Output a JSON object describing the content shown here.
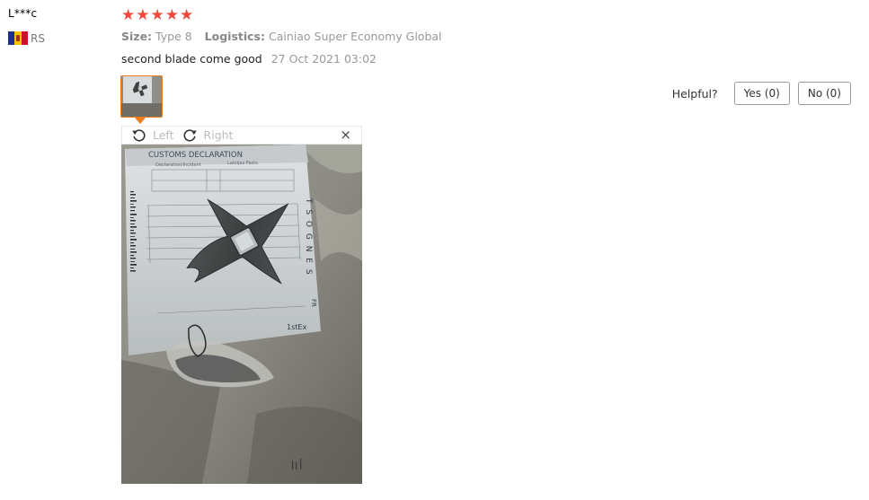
{
  "reviewer": {
    "name": "L***c",
    "country_code": "RS",
    "flag_icon": "flag-icon"
  },
  "rating": {
    "stars": 5,
    "max": 5,
    "color": "#f04a3c"
  },
  "attributes": {
    "size_label": "Size:",
    "size_value": "Type 8",
    "logistics_label": "Logistics:",
    "logistics_value": "Cainiao Super Economy Global"
  },
  "review": {
    "text": "second blade come good",
    "date": "27 Oct 2021 03:02"
  },
  "helpful": {
    "label": "Helpful?",
    "yes_label": "Yes (0)",
    "no_label": "No (0)"
  },
  "viewer": {
    "rotate_left_label": "Left",
    "rotate_right_label": "Right",
    "close_symbol": "×"
  },
  "photo": {
    "form_title": "CUSTOMS DECLARATION",
    "form_subtitle_left": "Declaration/Incident",
    "form_subtitle_right": "Latvijas Pasts",
    "side_text": "T S O G N E S",
    "corner_text": "1stEx",
    "fr_text": "FR"
  },
  "colors": {
    "accent_orange": "#f07c1a",
    "star_red": "#f04a3c"
  }
}
